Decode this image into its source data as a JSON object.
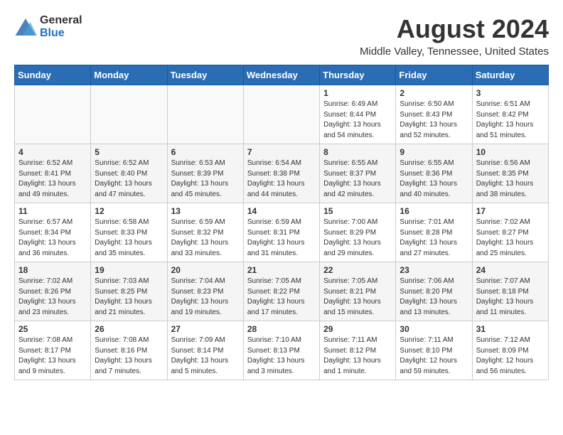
{
  "header": {
    "logo_general": "General",
    "logo_blue": "Blue",
    "month_title": "August 2024",
    "location": "Middle Valley, Tennessee, United States"
  },
  "days_of_week": [
    "Sunday",
    "Monday",
    "Tuesday",
    "Wednesday",
    "Thursday",
    "Friday",
    "Saturday"
  ],
  "weeks": [
    [
      {
        "day": "",
        "sunrise": "",
        "sunset": "",
        "daylight": ""
      },
      {
        "day": "",
        "sunrise": "",
        "sunset": "",
        "daylight": ""
      },
      {
        "day": "",
        "sunrise": "",
        "sunset": "",
        "daylight": ""
      },
      {
        "day": "",
        "sunrise": "",
        "sunset": "",
        "daylight": ""
      },
      {
        "day": "1",
        "sunrise": "6:49 AM",
        "sunset": "8:44 PM",
        "daylight": "13 hours and 54 minutes."
      },
      {
        "day": "2",
        "sunrise": "6:50 AM",
        "sunset": "8:43 PM",
        "daylight": "13 hours and 52 minutes."
      },
      {
        "day": "3",
        "sunrise": "6:51 AM",
        "sunset": "8:42 PM",
        "daylight": "13 hours and 51 minutes."
      }
    ],
    [
      {
        "day": "4",
        "sunrise": "6:52 AM",
        "sunset": "8:41 PM",
        "daylight": "13 hours and 49 minutes."
      },
      {
        "day": "5",
        "sunrise": "6:52 AM",
        "sunset": "8:40 PM",
        "daylight": "13 hours and 47 minutes."
      },
      {
        "day": "6",
        "sunrise": "6:53 AM",
        "sunset": "8:39 PM",
        "daylight": "13 hours and 45 minutes."
      },
      {
        "day": "7",
        "sunrise": "6:54 AM",
        "sunset": "8:38 PM",
        "daylight": "13 hours and 44 minutes."
      },
      {
        "day": "8",
        "sunrise": "6:55 AM",
        "sunset": "8:37 PM",
        "daylight": "13 hours and 42 minutes."
      },
      {
        "day": "9",
        "sunrise": "6:55 AM",
        "sunset": "8:36 PM",
        "daylight": "13 hours and 40 minutes."
      },
      {
        "day": "10",
        "sunrise": "6:56 AM",
        "sunset": "8:35 PM",
        "daylight": "13 hours and 38 minutes."
      }
    ],
    [
      {
        "day": "11",
        "sunrise": "6:57 AM",
        "sunset": "8:34 PM",
        "daylight": "13 hours and 36 minutes."
      },
      {
        "day": "12",
        "sunrise": "6:58 AM",
        "sunset": "8:33 PM",
        "daylight": "13 hours and 35 minutes."
      },
      {
        "day": "13",
        "sunrise": "6:59 AM",
        "sunset": "8:32 PM",
        "daylight": "13 hours and 33 minutes."
      },
      {
        "day": "14",
        "sunrise": "6:59 AM",
        "sunset": "8:31 PM",
        "daylight": "13 hours and 31 minutes."
      },
      {
        "day": "15",
        "sunrise": "7:00 AM",
        "sunset": "8:29 PM",
        "daylight": "13 hours and 29 minutes."
      },
      {
        "day": "16",
        "sunrise": "7:01 AM",
        "sunset": "8:28 PM",
        "daylight": "13 hours and 27 minutes."
      },
      {
        "day": "17",
        "sunrise": "7:02 AM",
        "sunset": "8:27 PM",
        "daylight": "13 hours and 25 minutes."
      }
    ],
    [
      {
        "day": "18",
        "sunrise": "7:02 AM",
        "sunset": "8:26 PM",
        "daylight": "13 hours and 23 minutes."
      },
      {
        "day": "19",
        "sunrise": "7:03 AM",
        "sunset": "8:25 PM",
        "daylight": "13 hours and 21 minutes."
      },
      {
        "day": "20",
        "sunrise": "7:04 AM",
        "sunset": "8:23 PM",
        "daylight": "13 hours and 19 minutes."
      },
      {
        "day": "21",
        "sunrise": "7:05 AM",
        "sunset": "8:22 PM",
        "daylight": "13 hours and 17 minutes."
      },
      {
        "day": "22",
        "sunrise": "7:05 AM",
        "sunset": "8:21 PM",
        "daylight": "13 hours and 15 minutes."
      },
      {
        "day": "23",
        "sunrise": "7:06 AM",
        "sunset": "8:20 PM",
        "daylight": "13 hours and 13 minutes."
      },
      {
        "day": "24",
        "sunrise": "7:07 AM",
        "sunset": "8:18 PM",
        "daylight": "13 hours and 11 minutes."
      }
    ],
    [
      {
        "day": "25",
        "sunrise": "7:08 AM",
        "sunset": "8:17 PM",
        "daylight": "13 hours and 9 minutes."
      },
      {
        "day": "26",
        "sunrise": "7:08 AM",
        "sunset": "8:16 PM",
        "daylight": "13 hours and 7 minutes."
      },
      {
        "day": "27",
        "sunrise": "7:09 AM",
        "sunset": "8:14 PM",
        "daylight": "13 hours and 5 minutes."
      },
      {
        "day": "28",
        "sunrise": "7:10 AM",
        "sunset": "8:13 PM",
        "daylight": "13 hours and 3 minutes."
      },
      {
        "day": "29",
        "sunrise": "7:11 AM",
        "sunset": "8:12 PM",
        "daylight": "13 hours and 1 minute."
      },
      {
        "day": "30",
        "sunrise": "7:11 AM",
        "sunset": "8:10 PM",
        "daylight": "12 hours and 59 minutes."
      },
      {
        "day": "31",
        "sunrise": "7:12 AM",
        "sunset": "8:09 PM",
        "daylight": "12 hours and 56 minutes."
      }
    ]
  ],
  "labels": {
    "sunrise": "Sunrise:",
    "sunset": "Sunset:",
    "daylight": "Daylight:"
  }
}
